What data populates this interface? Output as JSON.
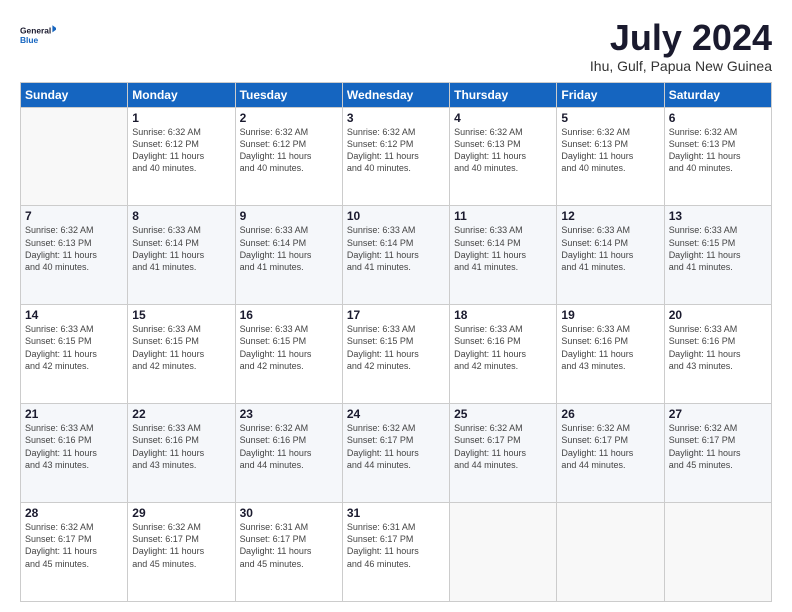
{
  "logo": {
    "line1": "General",
    "line2": "Blue"
  },
  "title": "July 2024",
  "subtitle": "Ihu, Gulf, Papua New Guinea",
  "weekdays": [
    "Sunday",
    "Monday",
    "Tuesday",
    "Wednesday",
    "Thursday",
    "Friday",
    "Saturday"
  ],
  "weeks": [
    [
      {
        "day": "",
        "info": ""
      },
      {
        "day": "1",
        "info": "Sunrise: 6:32 AM\nSunset: 6:12 PM\nDaylight: 11 hours\nand 40 minutes."
      },
      {
        "day": "2",
        "info": "Sunrise: 6:32 AM\nSunset: 6:12 PM\nDaylight: 11 hours\nand 40 minutes."
      },
      {
        "day": "3",
        "info": "Sunrise: 6:32 AM\nSunset: 6:12 PM\nDaylight: 11 hours\nand 40 minutes."
      },
      {
        "day": "4",
        "info": "Sunrise: 6:32 AM\nSunset: 6:13 PM\nDaylight: 11 hours\nand 40 minutes."
      },
      {
        "day": "5",
        "info": "Sunrise: 6:32 AM\nSunset: 6:13 PM\nDaylight: 11 hours\nand 40 minutes."
      },
      {
        "day": "6",
        "info": "Sunrise: 6:32 AM\nSunset: 6:13 PM\nDaylight: 11 hours\nand 40 minutes."
      }
    ],
    [
      {
        "day": "7",
        "info": "Sunrise: 6:32 AM\nSunset: 6:13 PM\nDaylight: 11 hours\nand 40 minutes."
      },
      {
        "day": "8",
        "info": "Sunrise: 6:33 AM\nSunset: 6:14 PM\nDaylight: 11 hours\nand 41 minutes."
      },
      {
        "day": "9",
        "info": "Sunrise: 6:33 AM\nSunset: 6:14 PM\nDaylight: 11 hours\nand 41 minutes."
      },
      {
        "day": "10",
        "info": "Sunrise: 6:33 AM\nSunset: 6:14 PM\nDaylight: 11 hours\nand 41 minutes."
      },
      {
        "day": "11",
        "info": "Sunrise: 6:33 AM\nSunset: 6:14 PM\nDaylight: 11 hours\nand 41 minutes."
      },
      {
        "day": "12",
        "info": "Sunrise: 6:33 AM\nSunset: 6:14 PM\nDaylight: 11 hours\nand 41 minutes."
      },
      {
        "day": "13",
        "info": "Sunrise: 6:33 AM\nSunset: 6:15 PM\nDaylight: 11 hours\nand 41 minutes."
      }
    ],
    [
      {
        "day": "14",
        "info": "Sunrise: 6:33 AM\nSunset: 6:15 PM\nDaylight: 11 hours\nand 42 minutes."
      },
      {
        "day": "15",
        "info": "Sunrise: 6:33 AM\nSunset: 6:15 PM\nDaylight: 11 hours\nand 42 minutes."
      },
      {
        "day": "16",
        "info": "Sunrise: 6:33 AM\nSunset: 6:15 PM\nDaylight: 11 hours\nand 42 minutes."
      },
      {
        "day": "17",
        "info": "Sunrise: 6:33 AM\nSunset: 6:15 PM\nDaylight: 11 hours\nand 42 minutes."
      },
      {
        "day": "18",
        "info": "Sunrise: 6:33 AM\nSunset: 6:16 PM\nDaylight: 11 hours\nand 42 minutes."
      },
      {
        "day": "19",
        "info": "Sunrise: 6:33 AM\nSunset: 6:16 PM\nDaylight: 11 hours\nand 43 minutes."
      },
      {
        "day": "20",
        "info": "Sunrise: 6:33 AM\nSunset: 6:16 PM\nDaylight: 11 hours\nand 43 minutes."
      }
    ],
    [
      {
        "day": "21",
        "info": "Sunrise: 6:33 AM\nSunset: 6:16 PM\nDaylight: 11 hours\nand 43 minutes."
      },
      {
        "day": "22",
        "info": "Sunrise: 6:33 AM\nSunset: 6:16 PM\nDaylight: 11 hours\nand 43 minutes."
      },
      {
        "day": "23",
        "info": "Sunrise: 6:32 AM\nSunset: 6:16 PM\nDaylight: 11 hours\nand 44 minutes."
      },
      {
        "day": "24",
        "info": "Sunrise: 6:32 AM\nSunset: 6:17 PM\nDaylight: 11 hours\nand 44 minutes."
      },
      {
        "day": "25",
        "info": "Sunrise: 6:32 AM\nSunset: 6:17 PM\nDaylight: 11 hours\nand 44 minutes."
      },
      {
        "day": "26",
        "info": "Sunrise: 6:32 AM\nSunset: 6:17 PM\nDaylight: 11 hours\nand 44 minutes."
      },
      {
        "day": "27",
        "info": "Sunrise: 6:32 AM\nSunset: 6:17 PM\nDaylight: 11 hours\nand 45 minutes."
      }
    ],
    [
      {
        "day": "28",
        "info": "Sunrise: 6:32 AM\nSunset: 6:17 PM\nDaylight: 11 hours\nand 45 minutes."
      },
      {
        "day": "29",
        "info": "Sunrise: 6:32 AM\nSunset: 6:17 PM\nDaylight: 11 hours\nand 45 minutes."
      },
      {
        "day": "30",
        "info": "Sunrise: 6:31 AM\nSunset: 6:17 PM\nDaylight: 11 hours\nand 45 minutes."
      },
      {
        "day": "31",
        "info": "Sunrise: 6:31 AM\nSunset: 6:17 PM\nDaylight: 11 hours\nand 46 minutes."
      },
      {
        "day": "",
        "info": ""
      },
      {
        "day": "",
        "info": ""
      },
      {
        "day": "",
        "info": ""
      }
    ]
  ]
}
